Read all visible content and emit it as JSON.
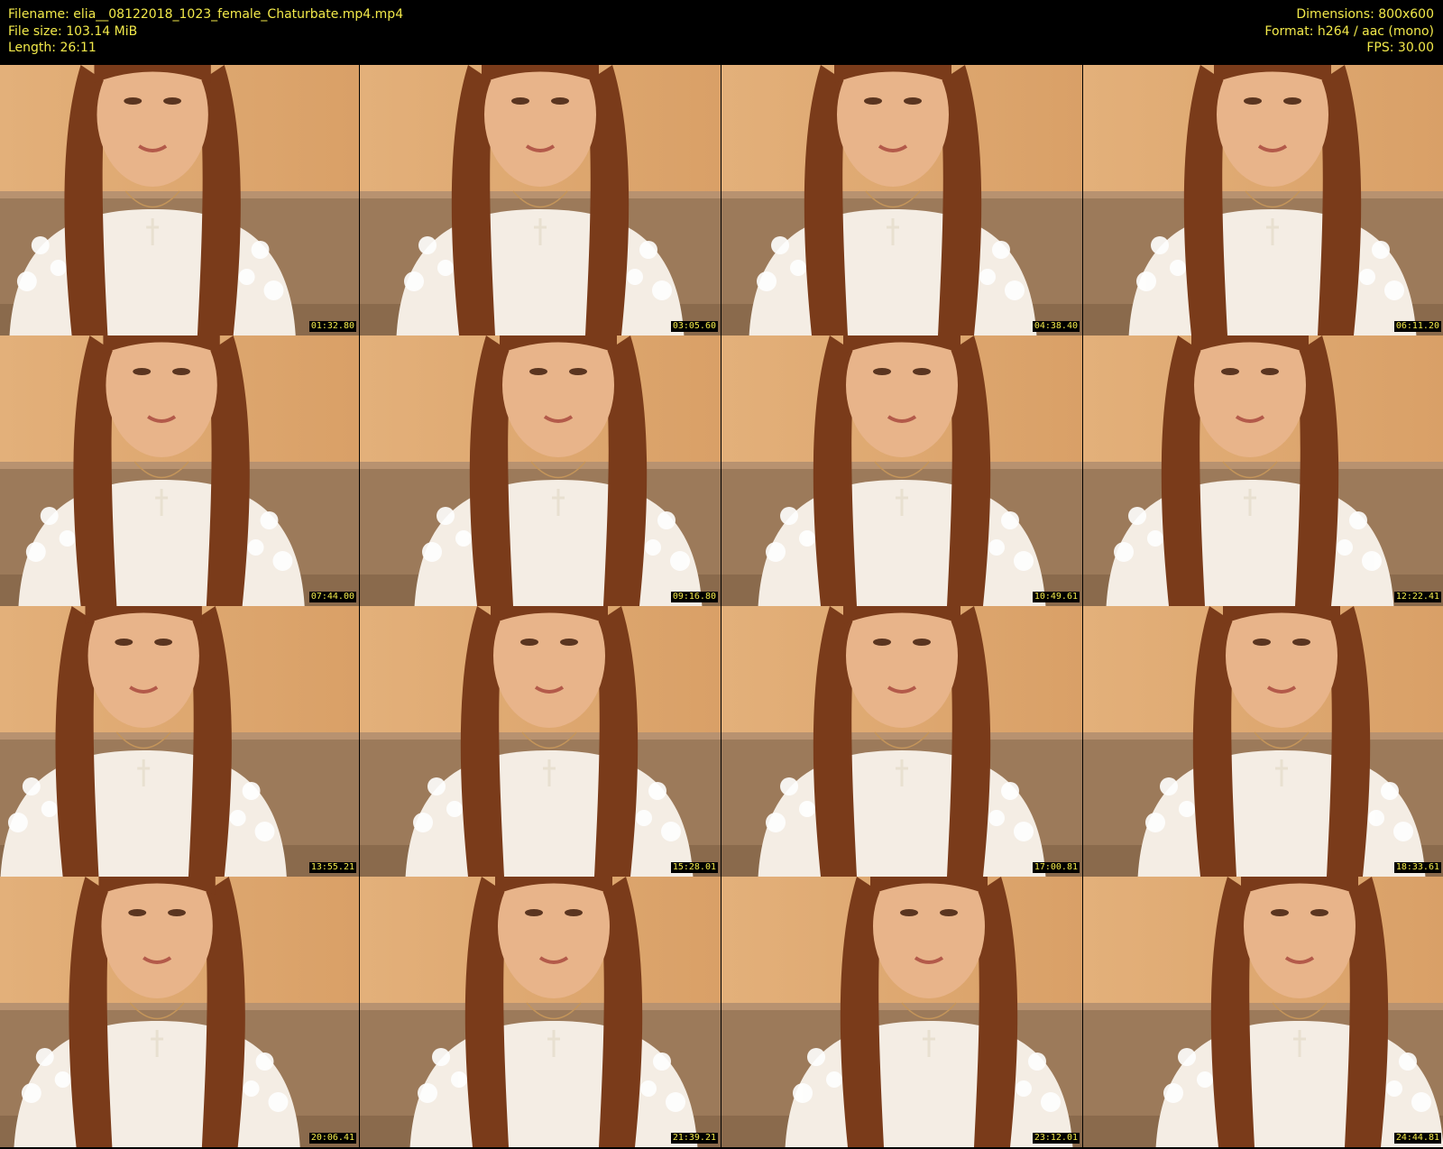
{
  "header": {
    "filename": "Filename: elia__08122018_1023_female_Chaturbate.mp4.mp4",
    "filesize": "File size: 103.14 MiB",
    "length": "Length: 26:11",
    "dimensions": "Dimensions: 800x600",
    "format": "Format: h264 / aac (mono)",
    "fps": "FPS: 30.00"
  },
  "thumbnails": [
    {
      "timestamp": "01:32.80"
    },
    {
      "timestamp": "03:05.60"
    },
    {
      "timestamp": "04:38.40"
    },
    {
      "timestamp": "06:11.20"
    },
    {
      "timestamp": "07:44.00"
    },
    {
      "timestamp": "09:16.80"
    },
    {
      "timestamp": "10:49.61"
    },
    {
      "timestamp": "12:22.41"
    },
    {
      "timestamp": "13:55.21"
    },
    {
      "timestamp": "15:28.01"
    },
    {
      "timestamp": "17:00.81"
    },
    {
      "timestamp": "18:33.61"
    },
    {
      "timestamp": "20:06.41"
    },
    {
      "timestamp": "21:39.21"
    },
    {
      "timestamp": "23:12.01"
    },
    {
      "timestamp": "24:44.81"
    }
  ],
  "colors": {
    "header_text": "#f2e94a",
    "background": "#000000",
    "wall": "#d9a067",
    "sofa": "#9c7a5a",
    "sweater": "#f4ede4",
    "hair": "#7a3b1a",
    "skin": "#e8b48a"
  }
}
